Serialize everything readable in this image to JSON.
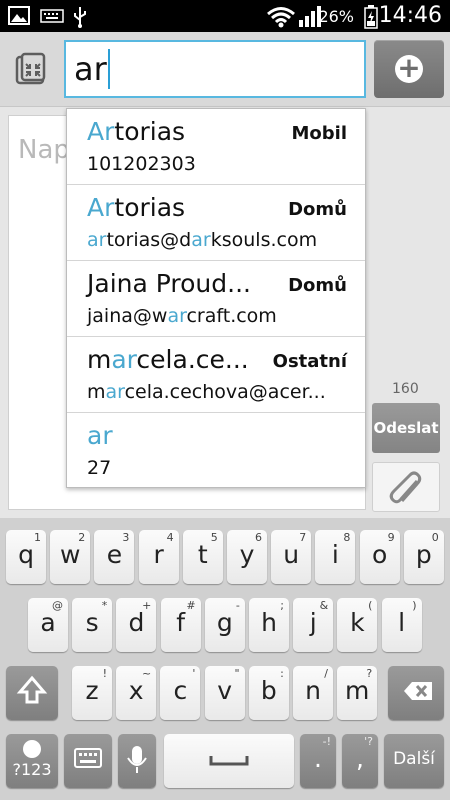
{
  "status_bar": {
    "battery": "26%",
    "time": "14:46"
  },
  "recipient": {
    "value": "ar"
  },
  "compose": {
    "placeholder": "Nap",
    "char_count": "160",
    "send_label": "Odeslat"
  },
  "suggestions": [
    {
      "name_hl": "Ar",
      "name_rest": "torias",
      "type": "Mobil",
      "detail_parts": [
        {
          "t": "101202303",
          "hl": false
        }
      ]
    },
    {
      "name_hl": "Ar",
      "name_rest": "torias",
      "type": "Domů",
      "detail_parts": [
        {
          "t": "ar",
          "hl": true
        },
        {
          "t": "torias@d",
          "hl": false
        },
        {
          "t": "ar",
          "hl": true
        },
        {
          "t": "ksouls.com",
          "hl": false
        }
      ]
    },
    {
      "name_hl": "",
      "name_rest": "Jaina Proud...",
      "type": "Domů",
      "detail_parts": [
        {
          "t": "jaina@w",
          "hl": false
        },
        {
          "t": "ar",
          "hl": true
        },
        {
          "t": "craft.com",
          "hl": false
        }
      ]
    },
    {
      "name_pre": "m",
      "name_hl": "ar",
      "name_rest": "cela.ce...",
      "type": "Ostatní",
      "detail_parts": [
        {
          "t": "m",
          "hl": false
        },
        {
          "t": "ar",
          "hl": true
        },
        {
          "t": "cela.cechova@acer...",
          "hl": false
        }
      ]
    },
    {
      "name_hl": "ar",
      "name_rest": "",
      "type": "",
      "detail_parts": [
        {
          "t": "27",
          "hl": false
        }
      ]
    }
  ],
  "keyboard": {
    "row1": [
      {
        "k": "q",
        "s": "1"
      },
      {
        "k": "w",
        "s": "2"
      },
      {
        "k": "e",
        "s": "3"
      },
      {
        "k": "r",
        "s": "4"
      },
      {
        "k": "t",
        "s": "5"
      },
      {
        "k": "y",
        "s": "6"
      },
      {
        "k": "u",
        "s": "7"
      },
      {
        "k": "i",
        "s": "8"
      },
      {
        "k": "o",
        "s": "9"
      },
      {
        "k": "p",
        "s": "0"
      }
    ],
    "row2": [
      {
        "k": "a",
        "s": "@"
      },
      {
        "k": "s",
        "s": "*"
      },
      {
        "k": "d",
        "s": "+"
      },
      {
        "k": "f",
        "s": "#"
      },
      {
        "k": "g",
        "s": "-"
      },
      {
        "k": "h",
        "s": ";"
      },
      {
        "k": "j",
        "s": "&"
      },
      {
        "k": "k",
        "s": "("
      },
      {
        "k": "l",
        "s": ")"
      }
    ],
    "row3": [
      {
        "k": "z",
        "s": "!"
      },
      {
        "k": "x",
        "s": "~"
      },
      {
        "k": "c",
        "s": "'"
      },
      {
        "k": "v",
        "s": "\""
      },
      {
        "k": "b",
        "s": ":"
      },
      {
        "k": "n",
        "s": "/"
      },
      {
        "k": "m",
        "s": "?"
      }
    ],
    "mode_label": "?123",
    "period": ".",
    "comma": ",",
    "period_sup": "-!",
    "comma_sup": "'?",
    "next_label": "Další"
  }
}
